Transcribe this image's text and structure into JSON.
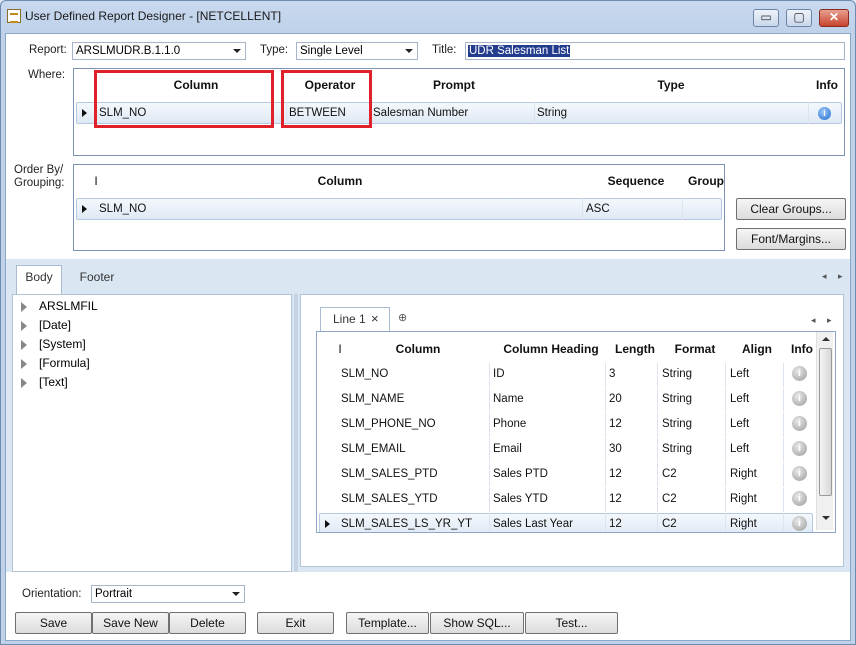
{
  "window": {
    "title": "User Defined Report Designer - [NETCELLENT]",
    "min_glyph": "▭",
    "max_glyph": "▢",
    "close_glyph": "✕"
  },
  "header": {
    "report_label": "Report:",
    "report_value": "ARSLMUDR.B.1.1.0",
    "type_label": "Type:",
    "type_value": "Single Level",
    "title_label": "Title:",
    "title_value": "UDR Salesman List",
    "where_label": "Where:",
    "orderby_label_1": "Order By/",
    "orderby_label_2": "Grouping:"
  },
  "where_grid": {
    "columns": [
      "Column",
      "Operator",
      "Prompt",
      "Type",
      "Info"
    ],
    "row": {
      "column": "SLM_NO",
      "operator": "BETWEEN",
      "prompt": "Salesman Number",
      "type": "String",
      "info": "i"
    }
  },
  "order_grid": {
    "columns": [
      "I",
      "Column",
      "Sequence",
      "Group"
    ],
    "row": {
      "column": "SLM_NO",
      "sequence": "ASC"
    }
  },
  "side_buttons": {
    "clear_groups": "Clear Groups...",
    "font_margins": "Font/Margins..."
  },
  "tabs": {
    "body": "Body",
    "footer": "Footer",
    "left_arrow": "◂",
    "right_arrow": "▸"
  },
  "tree": {
    "items": [
      "ARSLMFIL",
      "[Date]",
      "[System]",
      "[Formula]",
      "[Text]"
    ]
  },
  "line_tab": {
    "label": "Line 1",
    "close": "×",
    "add": "⊕"
  },
  "line_grid": {
    "columns": [
      "I",
      "Column",
      "Column Heading",
      "Length",
      "Format",
      "Align",
      "Info"
    ],
    "rows": [
      {
        "column": "SLM_NO",
        "heading": "ID",
        "length": "3",
        "format": "String",
        "align": "Left"
      },
      {
        "column": "SLM_NAME",
        "heading": "Name",
        "length": "20",
        "format": "String",
        "align": "Left"
      },
      {
        "column": "SLM_PHONE_NO",
        "heading": "Phone",
        "length": "12",
        "format": "String",
        "align": "Left"
      },
      {
        "column": "SLM_EMAIL",
        "heading": "Email",
        "length": "30",
        "format": "String",
        "align": "Left"
      },
      {
        "column": "SLM_SALES_PTD",
        "heading": "Sales PTD",
        "length": "12",
        "format": "C2",
        "align": "Right"
      },
      {
        "column": "SLM_SALES_YTD",
        "heading": "Sales YTD",
        "length": "12",
        "format": "C2",
        "align": "Right"
      },
      {
        "column": "SLM_SALES_LS_YR_YT",
        "heading": "Sales Last Year",
        "length": "12",
        "format": "C2",
        "align": "Right"
      }
    ],
    "info_glyph": "i"
  },
  "footer_bar": {
    "orientation_label": "Orientation:",
    "orientation_value": "Portrait",
    "buttons": [
      "Save",
      "Save New",
      "Delete",
      "Exit",
      "Template...",
      "Show SQL...",
      "Test..."
    ]
  },
  "colors": {
    "highlight_box": "#e0202a",
    "selection": "#233c8e"
  }
}
